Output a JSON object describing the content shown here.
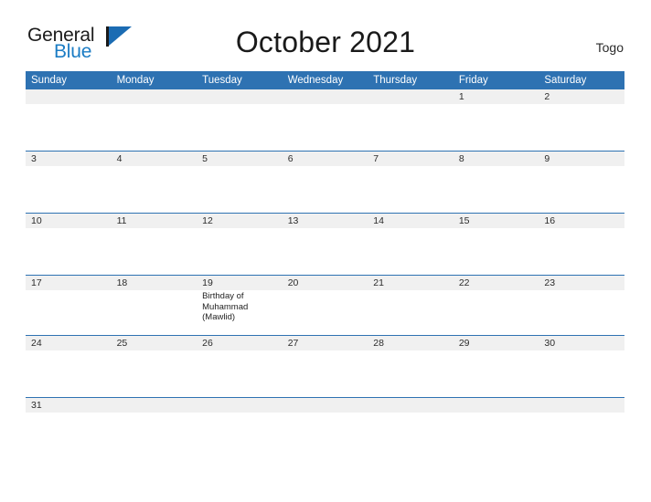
{
  "brand": {
    "word_one": "General",
    "word_two": "Blue",
    "flag_icon": "flag-icon",
    "color_dark": "#1c1c1c",
    "color_blue": "#1b7cc4"
  },
  "header": {
    "title": "October 2021",
    "region": "Togo"
  },
  "calendar": {
    "accent_color": "#2e72b2",
    "daynum_background": "#f0f0f0",
    "weekday_headers": [
      "Sunday",
      "Monday",
      "Tuesday",
      "Wednesday",
      "Thursday",
      "Friday",
      "Saturday"
    ],
    "weeks": [
      {
        "size": "normal",
        "days": [
          {
            "num": "",
            "events": []
          },
          {
            "num": "",
            "events": []
          },
          {
            "num": "",
            "events": []
          },
          {
            "num": "",
            "events": []
          },
          {
            "num": "",
            "events": []
          },
          {
            "num": "1",
            "events": []
          },
          {
            "num": "2",
            "events": []
          }
        ]
      },
      {
        "size": "normal",
        "days": [
          {
            "num": "3",
            "events": []
          },
          {
            "num": "4",
            "events": []
          },
          {
            "num": "5",
            "events": []
          },
          {
            "num": "6",
            "events": []
          },
          {
            "num": "7",
            "events": []
          },
          {
            "num": "8",
            "events": []
          },
          {
            "num": "9",
            "events": []
          }
        ]
      },
      {
        "size": "normal",
        "days": [
          {
            "num": "10",
            "events": []
          },
          {
            "num": "11",
            "events": []
          },
          {
            "num": "12",
            "events": []
          },
          {
            "num": "13",
            "events": []
          },
          {
            "num": "14",
            "events": []
          },
          {
            "num": "15",
            "events": []
          },
          {
            "num": "16",
            "events": []
          }
        ]
      },
      {
        "size": "short",
        "days": [
          {
            "num": "17",
            "events": []
          },
          {
            "num": "18",
            "events": []
          },
          {
            "num": "19",
            "events": [
              "Birthday of Muhammad (Mawlid)"
            ]
          },
          {
            "num": "20",
            "events": []
          },
          {
            "num": "21",
            "events": []
          },
          {
            "num": "22",
            "events": []
          },
          {
            "num": "23",
            "events": []
          }
        ]
      },
      {
        "size": "normal",
        "days": [
          {
            "num": "24",
            "events": []
          },
          {
            "num": "25",
            "events": []
          },
          {
            "num": "26",
            "events": []
          },
          {
            "num": "27",
            "events": []
          },
          {
            "num": "28",
            "events": []
          },
          {
            "num": "29",
            "events": []
          },
          {
            "num": "30",
            "events": []
          }
        ]
      },
      {
        "size": "last",
        "days": [
          {
            "num": "31",
            "events": []
          },
          {
            "num": "",
            "events": []
          },
          {
            "num": "",
            "events": []
          },
          {
            "num": "",
            "events": []
          },
          {
            "num": "",
            "events": []
          },
          {
            "num": "",
            "events": []
          },
          {
            "num": "",
            "events": []
          }
        ]
      }
    ]
  }
}
